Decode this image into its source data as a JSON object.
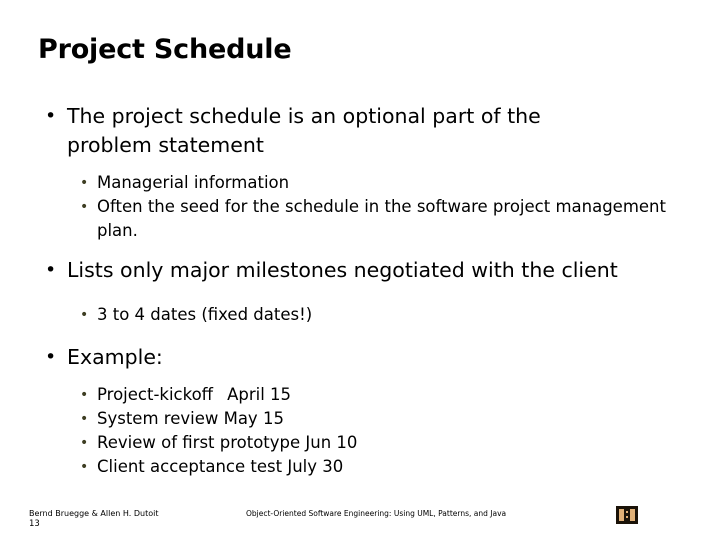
{
  "slide": {
    "title": "Project Schedule",
    "bullet_glyph": "•",
    "colors": {
      "background": "#ffffff",
      "text": "#000000",
      "level1_bullet": "#000000",
      "level2_bullet": "#3d3d22",
      "logo_dark": "#1a1208",
      "logo_tan": "#e0b077"
    },
    "content": [
      {
        "level": 1,
        "text": "The project schedule is an optional part of the problem statement"
      },
      {
        "level": 2,
        "text": "Managerial information"
      },
      {
        "level": 2,
        "text": "Often the seed for the schedule in the software project management plan."
      },
      {
        "level": 1,
        "text": "Lists only major milestones negotiated with the client"
      },
      {
        "level": 2,
        "text": "3 to 4 dates (fixed dates!)"
      },
      {
        "level": 1,
        "text": "Example:"
      },
      {
        "level": 2,
        "text": "Project-kickoff",
        "trailing": "April 15"
      },
      {
        "level": 2,
        "text": "System review May 15"
      },
      {
        "level": 2,
        "text": "Review of first prototype Jun 10"
      },
      {
        "level": 2,
        "text": "Client acceptance test July 30"
      }
    ]
  },
  "footer": {
    "authors": "Bernd Bruegge & Allen H. Dutoit",
    "page_number": "13",
    "book_title": "Object-Oriented Software Engineering: Using UML, Patterns, and Java",
    "logo_name": "book-logo"
  }
}
